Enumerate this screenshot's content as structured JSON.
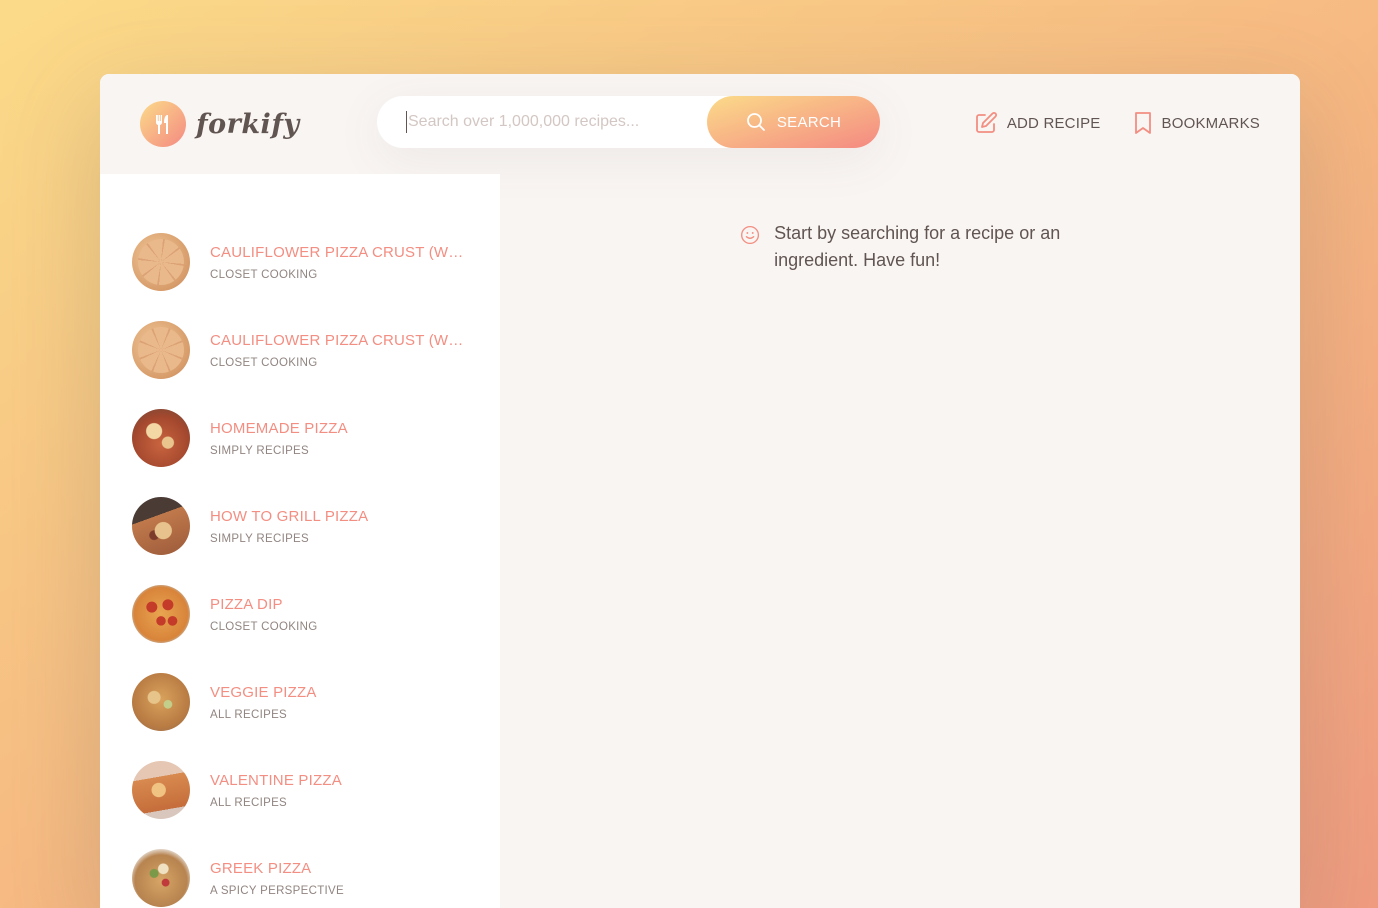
{
  "app": {
    "logo_text": "forkify",
    "colors": {
      "accent": "#f38e82",
      "accent_light": "#fbdb89",
      "text": "#615551",
      "muted": "#918581"
    }
  },
  "search": {
    "placeholder": "Search over 1,000,000 recipes...",
    "button_label": "SEARCH",
    "icon": "search-icon"
  },
  "nav": {
    "add_recipe": "ADD RECIPE",
    "bookmarks": "BOOKMARKS"
  },
  "results": [
    {
      "title": "CAULIFLOWER PIZZA CRUST (WIT...",
      "publisher": "CLOSET COOKING"
    },
    {
      "title": "CAULIFLOWER PIZZA CRUST (WIT...",
      "publisher": "CLOSET COOKING"
    },
    {
      "title": "HOMEMADE PIZZA",
      "publisher": "SIMPLY RECIPES"
    },
    {
      "title": "HOW TO GRILL PIZZA",
      "publisher": "SIMPLY RECIPES"
    },
    {
      "title": "PIZZA DIP",
      "publisher": "CLOSET COOKING"
    },
    {
      "title": "VEGGIE PIZZA",
      "publisher": "ALL RECIPES"
    },
    {
      "title": "VALENTINE PIZZA",
      "publisher": "ALL RECIPES"
    },
    {
      "title": "GREEK PIZZA",
      "publisher": "A SPICY PERSPECTIVE"
    }
  ],
  "message": {
    "text": "Start by searching for a recipe or an ingredient. Have fun!",
    "icon": "smile-icon"
  }
}
